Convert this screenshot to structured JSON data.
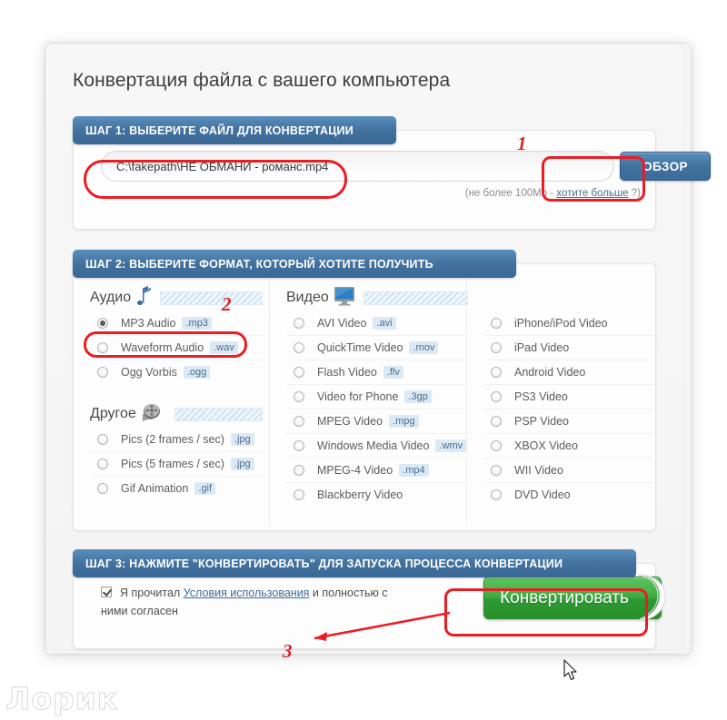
{
  "page": {
    "title": "Конвертация файла с вашего компьютера",
    "watermark": "Лорик"
  },
  "colors": {
    "step_header_blue": "#43729f",
    "browse_button_blue": "#3a6b99",
    "convert_green": "#3fae42",
    "annotation_red": "#ec1c24",
    "ext_badge_bg": "#dbe9f5"
  },
  "step1": {
    "header": "ШАГ 1: ВЫБЕРИТЕ ФАЙЛ ДЛЯ КОНВЕРТАЦИИ",
    "file_value": "C:\\fakepath\\НЕ ОБМАНИ - романс.mp4",
    "file_placeholder": "",
    "browse_label": "ОБЗОР",
    "limit_prefix": "(не более 100Mb - ",
    "limit_link": "хотите больше",
    "limit_suffix": " ?)"
  },
  "step2": {
    "header": "ШАГ 2: ВЫБЕРИТЕ ФОРМАТ, КОТОРЫЙ ХОТИТЕ ПОЛУЧИТЬ",
    "groups": [
      {
        "name": "Аудио",
        "icon": "music-note-icon",
        "options": [
          {
            "label": "MP3 Audio",
            "ext": ".mp3",
            "checked": true
          },
          {
            "label": "Waveform Audio",
            "ext": ".wav",
            "checked": false
          },
          {
            "label": "Ogg Vorbis",
            "ext": ".ogg",
            "checked": false
          }
        ]
      },
      {
        "name": "Другое",
        "icon": "film-reel-icon",
        "options": [
          {
            "label": "Pics (2 frames / sec)",
            "ext": ".jpg",
            "checked": false
          },
          {
            "label": "Pics (5 frames / sec)",
            "ext": ".jpg",
            "checked": false
          },
          {
            "label": "Gif Animation",
            "ext": ".gif",
            "checked": false
          }
        ]
      },
      {
        "name": "Видео",
        "icon": "monitor-icon",
        "options": [
          {
            "label": "AVI Video",
            "ext": ".avi",
            "checked": false
          },
          {
            "label": "QuickTime Video",
            "ext": ".mov",
            "checked": false
          },
          {
            "label": "Flash Video",
            "ext": ".flv",
            "checked": false
          },
          {
            "label": "Video for Phone",
            "ext": ".3gp",
            "checked": false
          },
          {
            "label": "MPEG Video",
            "ext": ".mpg",
            "checked": false
          },
          {
            "label": "Windows Media Video",
            "ext": ".wmv",
            "checked": false
          },
          {
            "label": "MPEG-4 Video",
            "ext": ".mp4",
            "checked": false
          },
          {
            "label": "Blackberry Video",
            "ext": "",
            "checked": false
          }
        ]
      },
      {
        "name": "",
        "icon": "",
        "options": [
          {
            "label": "iPhone/iPod Video",
            "ext": "",
            "checked": false
          },
          {
            "label": "iPad Video",
            "ext": "",
            "checked": false
          },
          {
            "label": "Android Video",
            "ext": "",
            "checked": false
          },
          {
            "label": "PS3 Video",
            "ext": "",
            "checked": false
          },
          {
            "label": "PSP Video",
            "ext": "",
            "checked": false
          },
          {
            "label": "XBOX Video",
            "ext": "",
            "checked": false
          },
          {
            "label": "WII Video",
            "ext": "",
            "checked": false
          },
          {
            "label": "DVD Video",
            "ext": "",
            "checked": false
          }
        ]
      }
    ]
  },
  "step3": {
    "header": "ШАГ 3: НАЖМИТЕ \"КОНВЕРТИРОВАТЬ\" ДЛЯ ЗАПУСКА ПРОЦЕССА КОНВЕРТАЦИИ",
    "agree_checked": true,
    "agree_prefix": "Я прочитал ",
    "agree_link": "Условия использования",
    "agree_suffix": " и полностью с ними согласен",
    "convert_label": "Конвертировать"
  },
  "annotations": {
    "n1": "1",
    "n2": "2",
    "n3": "3"
  }
}
